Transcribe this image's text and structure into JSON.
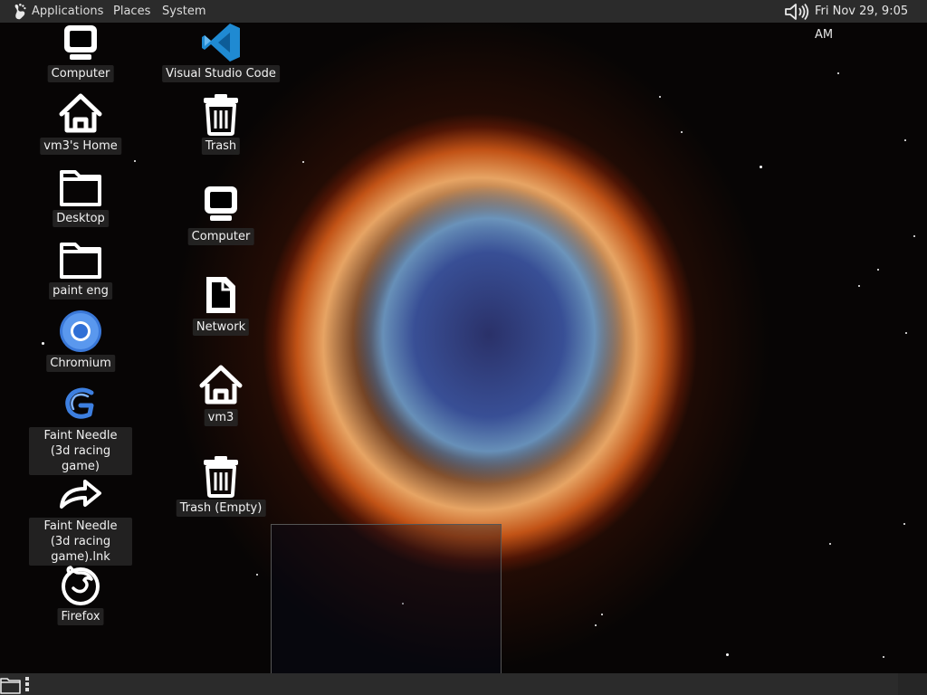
{
  "top_panel": {
    "menus": [
      "Applications",
      "Places",
      "System"
    ],
    "clock": "Fri Nov 29,  9:05 AM"
  },
  "desktop": {
    "left_column": [
      {
        "label": "Computer",
        "icon": "computer-icon"
      },
      {
        "label": "vm3's Home",
        "icon": "home-icon"
      },
      {
        "label": "Desktop",
        "icon": "folder-icon"
      },
      {
        "label": "paint eng",
        "icon": "folder-icon"
      },
      {
        "label": "Chromium",
        "icon": "chromium-icon"
      },
      {
        "label": "Faint Needle (3d racing game)",
        "icon": "game-icon"
      },
      {
        "label": "Faint Needle (3d racing game).lnk",
        "icon": "shortcut-arrow-icon"
      },
      {
        "label": "Firefox",
        "icon": "firefox-icon"
      }
    ],
    "right_column": [
      {
        "label": "Visual Studio Code",
        "icon": "vscode-icon"
      },
      {
        "label": "Trash",
        "icon": "trash-icon"
      },
      {
        "label": "Computer",
        "icon": "computer-icon"
      },
      {
        "label": "Network",
        "icon": "file-icon"
      },
      {
        "label": "vm3",
        "icon": "home-icon"
      },
      {
        "label": "Trash (Empty)",
        "icon": "trash-icon"
      }
    ]
  },
  "colors": {
    "panel": "#2b2b2b",
    "panel_text": "#e6e6e6",
    "chromium_blue": "#4a8ef0",
    "vscode_blue": "#1f8ad2"
  }
}
